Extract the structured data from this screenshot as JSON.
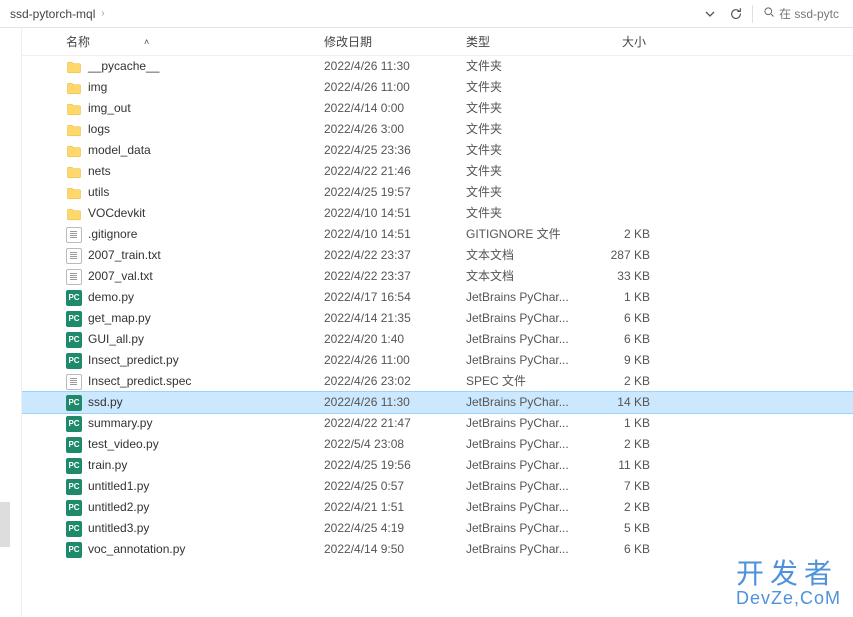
{
  "breadcrumb": {
    "current": "ssd-pytorch-mql"
  },
  "search": {
    "placeholder": "在 ssd-pytc"
  },
  "columns": {
    "name": "名称",
    "date": "修改日期",
    "type": "类型",
    "size": "大小"
  },
  "types": {
    "folder": "文件夹",
    "gitignore": "GITIGNORE 文件",
    "txt": "文本文档",
    "py": "JetBrains PyChar...",
    "spec": "SPEC 文件"
  },
  "selected": "ssd.py",
  "files": [
    {
      "icon": "folder",
      "name": "__pycache__",
      "date": "2022/4/26 11:30",
      "typeKey": "folder",
      "size": ""
    },
    {
      "icon": "folder",
      "name": "img",
      "date": "2022/4/26 11:00",
      "typeKey": "folder",
      "size": ""
    },
    {
      "icon": "folder",
      "name": "img_out",
      "date": "2022/4/14 0:00",
      "typeKey": "folder",
      "size": ""
    },
    {
      "icon": "folder",
      "name": "logs",
      "date": "2022/4/26 3:00",
      "typeKey": "folder",
      "size": ""
    },
    {
      "icon": "folder",
      "name": "model_data",
      "date": "2022/4/25 23:36",
      "typeKey": "folder",
      "size": ""
    },
    {
      "icon": "folder",
      "name": "nets",
      "date": "2022/4/22 21:46",
      "typeKey": "folder",
      "size": ""
    },
    {
      "icon": "folder",
      "name": "utils",
      "date": "2022/4/25 19:57",
      "typeKey": "folder",
      "size": ""
    },
    {
      "icon": "folder",
      "name": "VOCdevkit",
      "date": "2022/4/10 14:51",
      "typeKey": "folder",
      "size": ""
    },
    {
      "icon": "txt",
      "name": ".gitignore",
      "date": "2022/4/10 14:51",
      "typeKey": "gitignore",
      "size": "2 KB"
    },
    {
      "icon": "txt",
      "name": "2007_train.txt",
      "date": "2022/4/22 23:37",
      "typeKey": "txt",
      "size": "287 KB"
    },
    {
      "icon": "txt",
      "name": "2007_val.txt",
      "date": "2022/4/22 23:37",
      "typeKey": "txt",
      "size": "33 KB"
    },
    {
      "icon": "py",
      "name": "demo.py",
      "date": "2022/4/17 16:54",
      "typeKey": "py",
      "size": "1 KB"
    },
    {
      "icon": "py",
      "name": "get_map.py",
      "date": "2022/4/14 21:35",
      "typeKey": "py",
      "size": "6 KB"
    },
    {
      "icon": "py",
      "name": "GUI_all.py",
      "date": "2022/4/20 1:40",
      "typeKey": "py",
      "size": "6 KB"
    },
    {
      "icon": "py",
      "name": "Insect_predict.py",
      "date": "2022/4/26 11:00",
      "typeKey": "py",
      "size": "9 KB"
    },
    {
      "icon": "txt",
      "name": "Insect_predict.spec",
      "date": "2022/4/26 23:02",
      "typeKey": "spec",
      "size": "2 KB"
    },
    {
      "icon": "py",
      "name": "ssd.py",
      "date": "2022/4/26 11:30",
      "typeKey": "py",
      "size": "14 KB"
    },
    {
      "icon": "py",
      "name": "summary.py",
      "date": "2022/4/22 21:47",
      "typeKey": "py",
      "size": "1 KB"
    },
    {
      "icon": "py",
      "name": "test_video.py",
      "date": "2022/5/4 23:08",
      "typeKey": "py",
      "size": "2 KB"
    },
    {
      "icon": "py",
      "name": "train.py",
      "date": "2022/4/25 19:56",
      "typeKey": "py",
      "size": "11 KB"
    },
    {
      "icon": "py",
      "name": "untitled1.py",
      "date": "2022/4/25 0:57",
      "typeKey": "py",
      "size": "7 KB"
    },
    {
      "icon": "py",
      "name": "untitled2.py",
      "date": "2022/4/21 1:51",
      "typeKey": "py",
      "size": "2 KB"
    },
    {
      "icon": "py",
      "name": "untitled3.py",
      "date": "2022/4/25 4:19",
      "typeKey": "py",
      "size": "5 KB"
    },
    {
      "icon": "py",
      "name": "voc_annotation.py",
      "date": "2022/4/14 9:50",
      "typeKey": "py",
      "size": "6 KB"
    }
  ],
  "watermark": {
    "line1": "开发者",
    "line2": "DevZe,CoM"
  }
}
